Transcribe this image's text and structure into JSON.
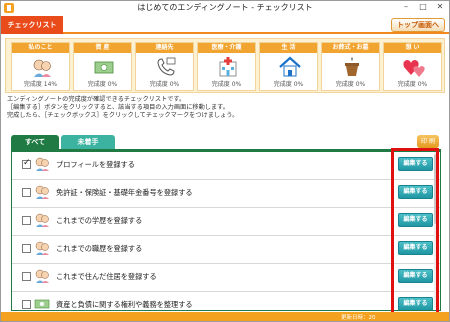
{
  "window": {
    "title": "はじめてのエンディングノート - チェックリスト",
    "controls": [
      "–",
      "□",
      "✕"
    ]
  },
  "header": {
    "label": "チェックリスト",
    "top_button": "トップ画面へ"
  },
  "categories": [
    {
      "title": "私のこと",
      "status": "完成度 14%",
      "icon": "person-icon",
      "color": "#f2a431"
    },
    {
      "title": "資 産",
      "status": "完成度 0%",
      "icon": "money-icon",
      "color": "#f2a431"
    },
    {
      "title": "連絡先",
      "status": "完成度 0%",
      "icon": "phone-icon",
      "color": "#f2a431"
    },
    {
      "title": "医療・介護",
      "status": "完成度 0%",
      "icon": "hospital-icon",
      "color": "#f2a431"
    },
    {
      "title": "生 活",
      "status": "完成度 0%",
      "icon": "house-icon",
      "color": "#f2a431"
    },
    {
      "title": "お葬式・お墓",
      "status": "完成度 0%",
      "icon": "urn-icon",
      "color": "#f2a431"
    },
    {
      "title": "想 い",
      "status": "完成度 0%",
      "icon": "hearts-icon",
      "color": "#f2a431"
    }
  ],
  "description": {
    "line1": "エンディングノートの完成度が確認できるチェックリストです。",
    "line2": "［編集する］ボタンをクリックすると、該当する項目の入力画面に移動します。",
    "line3": "完成したら、［チェックボックス］をクリックしてチェックマークをつけましょう。"
  },
  "tabs": {
    "all": "すべて",
    "undone": "未着手",
    "print": "印 刷"
  },
  "items": [
    {
      "label": "プロフィールを登録する",
      "checked": true,
      "button": "編集する"
    },
    {
      "label": "免許証・保険証・基礎年金番号を登録する",
      "checked": false,
      "button": "編集する"
    },
    {
      "label": "これまでの学歴を登録する",
      "checked": false,
      "button": "編集する"
    },
    {
      "label": "これまでの職歴を登録する",
      "checked": false,
      "button": "編集する"
    },
    {
      "label": "これまで住んだ住居を登録する",
      "checked": false,
      "button": "編集する"
    },
    {
      "label": "資産と負債に関する権利や義務を整理する",
      "checked": false,
      "button": "編集する"
    }
  ],
  "footer": {
    "updated": "更新日時：20"
  },
  "colors": {
    "accent_orange": "#f3a11f",
    "header_red": "#e94b1a",
    "tab_green": "#1f7a44",
    "button_teal": "#1f96a3",
    "highlight_red": "#e01010"
  }
}
